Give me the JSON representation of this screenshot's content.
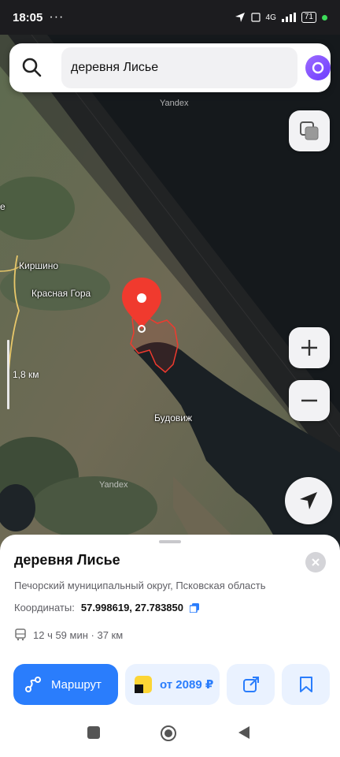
{
  "status_bar": {
    "time": "18:05",
    "dots": "···",
    "battery": "71",
    "network": "4G"
  },
  "search": {
    "query": "деревня Лисье"
  },
  "map": {
    "labels": {
      "kirshino": "Киршино",
      "krasnaya_gora": "Красная Гора",
      "budovizh": "Будовиж",
      "edge_e": "е"
    },
    "watermark": "Yandex",
    "scale": "1,8 км"
  },
  "place": {
    "title": "деревня Лисье",
    "subtitle": "Печорский муниципальный округ, Псковская область",
    "coords_label": "Координаты:",
    "coords_value": "57.998619, 27.783850",
    "route_info": "12 ч 59 мин · 37 км"
  },
  "actions": {
    "route_label": "Маршрут",
    "taxi_label": "от 2089 ₽"
  },
  "colors": {
    "accent": "#2a7dfc",
    "pin": "#f03a2e"
  }
}
